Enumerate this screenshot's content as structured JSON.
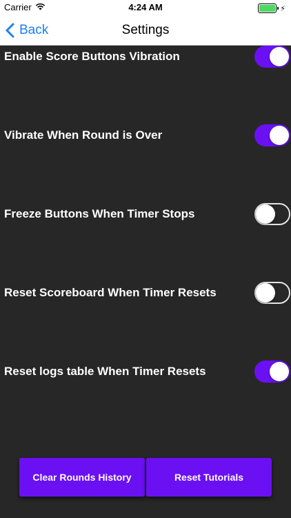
{
  "status_bar": {
    "carrier": "Carrier",
    "time": "4:24 AM",
    "battery_color": "#4cd964"
  },
  "nav": {
    "back_label": "Back",
    "title": "Settings",
    "accent_color": "#1a7ef5"
  },
  "settings": [
    {
      "label": "Enable Score Buttons Vibration",
      "on": true
    },
    {
      "label": "Vibrate When Round is Over",
      "on": true
    },
    {
      "label": "Freeze Buttons When Timer Stops",
      "on": false
    },
    {
      "label": "Reset Scoreboard When Timer Resets",
      "on": false
    },
    {
      "label": "Reset logs table When Timer Resets",
      "on": true
    }
  ],
  "buttons": {
    "clear_rounds": "Clear Rounds History",
    "reset_tutorials": "Reset Tutorials"
  },
  "colors": {
    "background": "#272727",
    "accent": "#6b10f3"
  },
  "icons": {
    "wifi": "wifi-icon",
    "battery": "battery-icon",
    "charging": "charging-bolt-icon",
    "back": "chevron-left-icon"
  }
}
